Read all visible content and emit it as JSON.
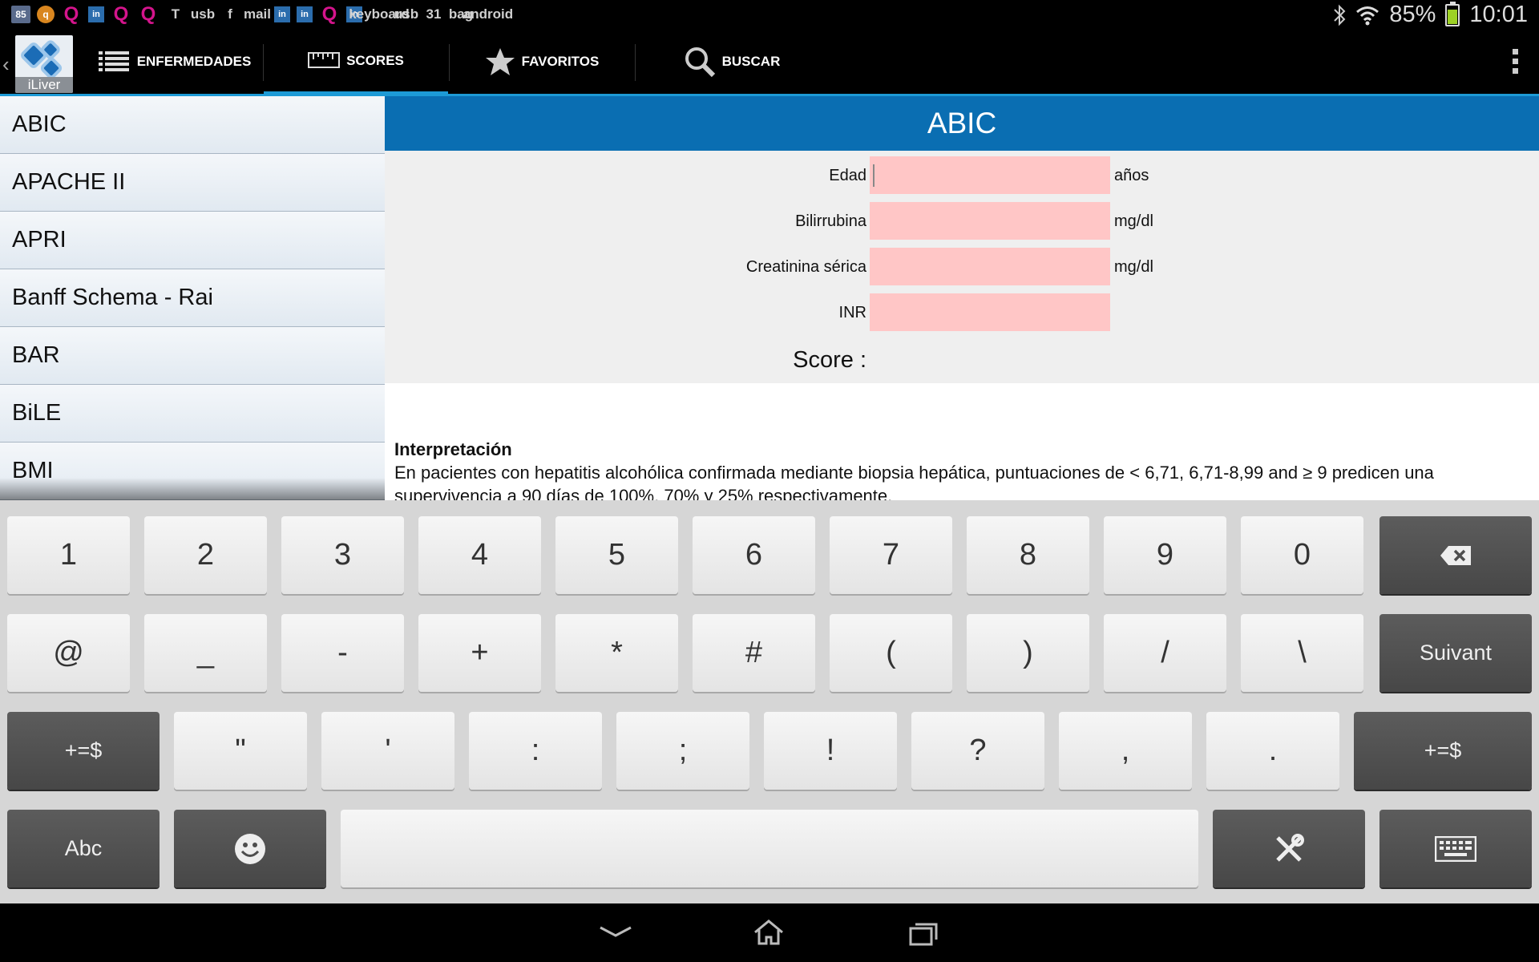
{
  "status_bar": {
    "notification_icons": [
      "85",
      "q",
      "Q",
      "in",
      "Q",
      "Q",
      "T",
      "usb",
      "f",
      "mail",
      "in",
      "in",
      "Q",
      "in",
      "keyboard",
      "usb",
      "31",
      "bag",
      "android"
    ],
    "battery": "85%",
    "time": "10:01"
  },
  "app": {
    "logo_text": "iLiver",
    "tabs": [
      {
        "label": "ENFERMEDADES",
        "icon": "list-icon"
      },
      {
        "label": "SCORES",
        "icon": "ruler-icon",
        "active": true
      },
      {
        "label": "FAVORITOS",
        "icon": "star-icon"
      },
      {
        "label": "BUSCAR",
        "icon": "search-icon"
      }
    ]
  },
  "score_list": [
    "ABIC",
    "APACHE II",
    "APRI",
    "Banff Schema - Rai",
    "BAR",
    "BiLE",
    "BMI"
  ],
  "calculator": {
    "title": "ABIC",
    "fields": [
      {
        "label": "Edad",
        "value": "",
        "unit": "años"
      },
      {
        "label": "Bilirrubina",
        "value": "",
        "unit": "mg/dl"
      },
      {
        "label": "Creatinina sérica",
        "value": "",
        "unit": "mg/dl"
      },
      {
        "label": "INR",
        "value": "",
        "unit": ""
      }
    ],
    "score_label": "Score :",
    "interpretation_title": "Interpretación",
    "interpretation_text": "En pacientes con hepatitis alcohólica confirmada mediante biopsia hepática, puntuaciones de < 6,71, 6,71-8,99 and ≥ 9 predicen una supervivencia a 90 días de 100%, 70% y 25% respectivamente."
  },
  "keyboard": {
    "row1": [
      "1",
      "2",
      "3",
      "4",
      "5",
      "6",
      "7",
      "8",
      "9",
      "0"
    ],
    "row2": [
      "@",
      "_",
      "-",
      "+",
      "*",
      "#",
      "(",
      ")",
      "/",
      "\\"
    ],
    "row2_action": "Suivant",
    "row3_shift": "+=$",
    "row3": [
      "\"",
      "'",
      ":",
      ";",
      "!",
      "?",
      ",",
      "."
    ],
    "row4_abc": "Abc"
  },
  "accent_colors": {
    "header_blue": "#0a6eb2",
    "tab_indicator": "#1d9ad6",
    "input_invalid": "#ffc6c6"
  }
}
